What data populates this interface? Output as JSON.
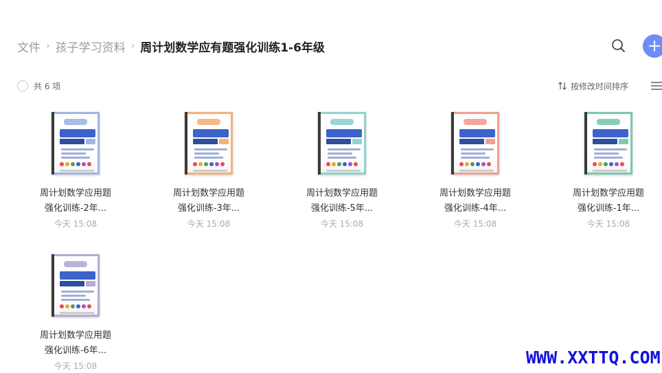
{
  "breadcrumb": {
    "items": [
      "文件",
      "孩子学习资料"
    ],
    "separator": "›",
    "current": "周计划数学应有题强化训练1-6年级"
  },
  "icons": {
    "search": "search-icon",
    "add": "plus-icon",
    "sort": "sort-arrows-icon",
    "view": "list-view-icon"
  },
  "toolbar": {
    "count_text": "共 6 项",
    "sort_label": "按修改时间排序"
  },
  "colors": {
    "accent": "#6f8df5"
  },
  "files": [
    {
      "name_line1": "周计划数学应用题",
      "name_line2": "强化训练-2年...",
      "time": "今天 15:08",
      "cover_color": "#9fb6e0"
    },
    {
      "name_line1": "周计划数学应用题",
      "name_line2": "强化训练-3年...",
      "time": "今天 15:08",
      "cover_color": "#f3b27a"
    },
    {
      "name_line1": "周计划数学应用题",
      "name_line2": "强化训练-5年...",
      "time": "今天 15:08",
      "cover_color": "#8ed3cf"
    },
    {
      "name_line1": "周计划数学应用题",
      "name_line2": "强化训练-4年...",
      "time": "今天 15:08",
      "cover_color": "#f0a190"
    },
    {
      "name_line1": "周计划数学应用题",
      "name_line2": "强化训练-1年...",
      "time": "今天 15:08",
      "cover_color": "#7cc8b0"
    },
    {
      "name_line1": "周计划数学应用题",
      "name_line2": "强化训练-6年...",
      "time": "今天 15:08",
      "cover_color": "#b6a8d8"
    }
  ],
  "watermark": "WWW.XXTTQ.COM"
}
